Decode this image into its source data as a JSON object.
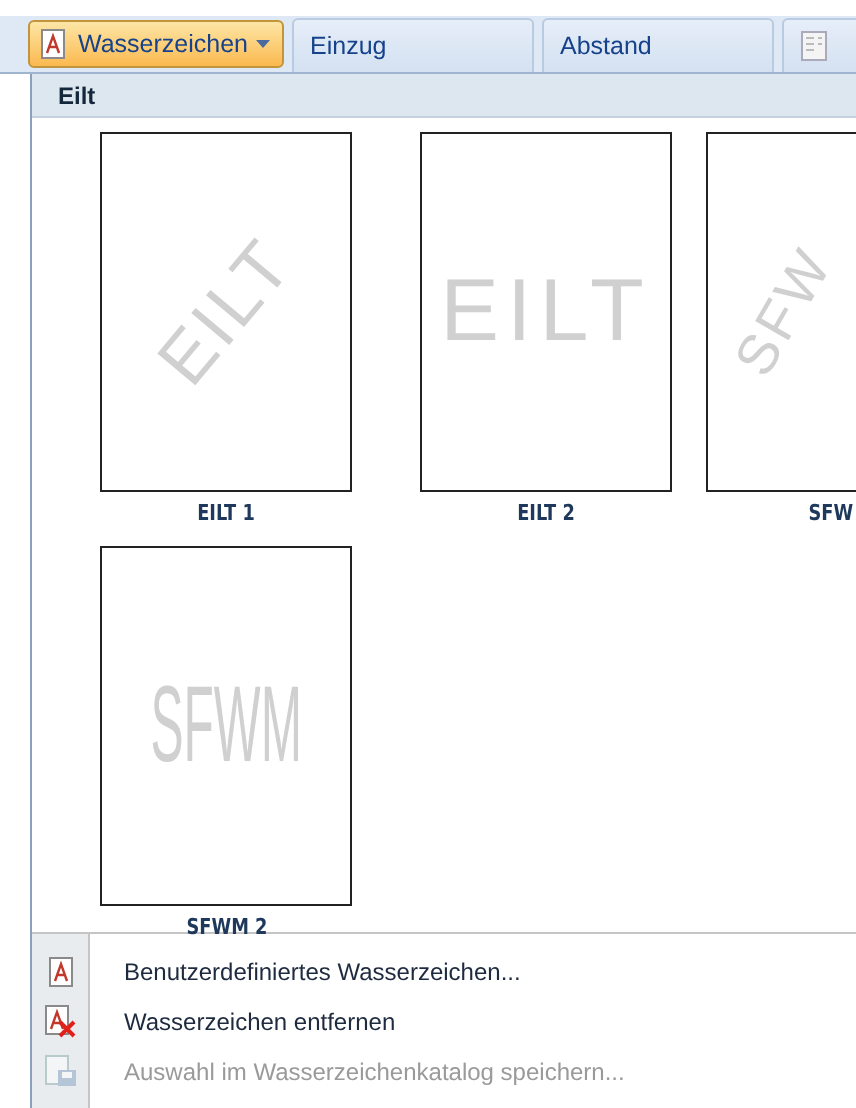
{
  "ribbon": {
    "groups": [
      {
        "label": "Wasserzeichen",
        "kind": "dropdown",
        "selected": true
      },
      {
        "label": "Einzug",
        "kind": "group",
        "selected": false
      },
      {
        "label": "Abstand",
        "kind": "group",
        "selected": false
      },
      {
        "kind": "icon",
        "selected": false
      }
    ]
  },
  "gallery": {
    "heading": "Eilt",
    "items": [
      {
        "label": "EILT 1",
        "watermark": "EILT",
        "kind": "diagonal",
        "cut": false
      },
      {
        "label": "EILT 2",
        "watermark": "EILT",
        "kind": "horizontal",
        "cut": false
      },
      {
        "label": "SFW",
        "watermark": "SFW",
        "kind": "diagonal",
        "cut": true
      },
      {
        "label": "SFWM 2",
        "watermark": "SFWM",
        "kind": "tall",
        "cut": false
      }
    ]
  },
  "menu": [
    {
      "label": "Benutzerdefiniertes Wasserzeichen...",
      "kind": "custom",
      "disabled": false
    },
    {
      "label": "Wasserzeichen entfernen",
      "kind": "remove",
      "disabled": false
    },
    {
      "label": "Auswahl im Wasserzeichenkatalog speichern...",
      "kind": "save",
      "disabled": true
    }
  ]
}
